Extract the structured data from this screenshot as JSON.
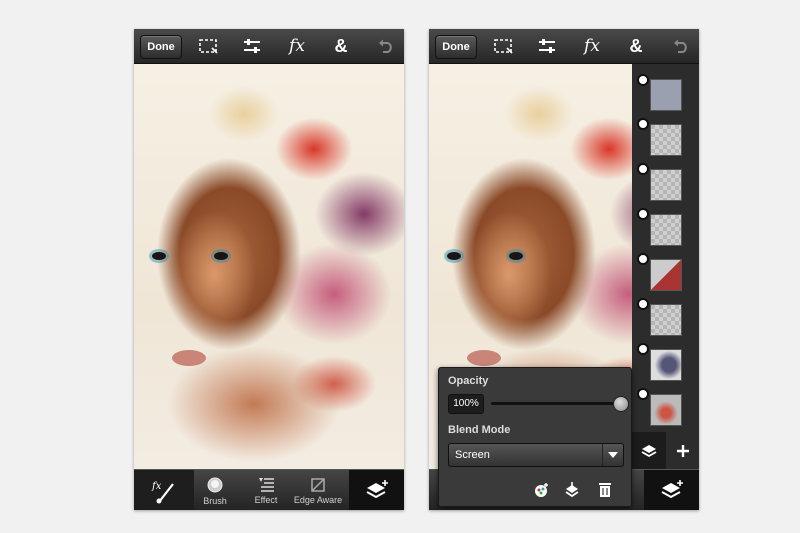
{
  "toolbar": {
    "done_label": "Done",
    "fx_label": "fx",
    "ampersand_label": "&"
  },
  "bottom_tools": {
    "brush_label": "Brush",
    "effect_label": "Effect",
    "edge_aware_label": "Edge Aware"
  },
  "layer_props": {
    "opacity_label": "Opacity",
    "opacity_value": "100%",
    "opacity_level": 1.0,
    "blend_mode_label": "Blend Mode",
    "blend_mode_value": "Screen"
  },
  "layers_panel": {
    "layer_count": 8
  },
  "icons": [
    "marquee-icon",
    "adjustments-icon",
    "fx-icon",
    "ampersand-icon",
    "undo-icon",
    "fx-brush-icon",
    "brush-icon",
    "effect-icon",
    "edge-aware-icon",
    "add-layer-icon",
    "layers-icon",
    "plus-icon",
    "merge-icon",
    "trash-icon",
    "chevron-down-icon"
  ],
  "colors": {
    "toolbar_bg": "#2e2e2e",
    "page_bg": "#f1f1f1",
    "popup_bg": "#3a3a3a"
  }
}
